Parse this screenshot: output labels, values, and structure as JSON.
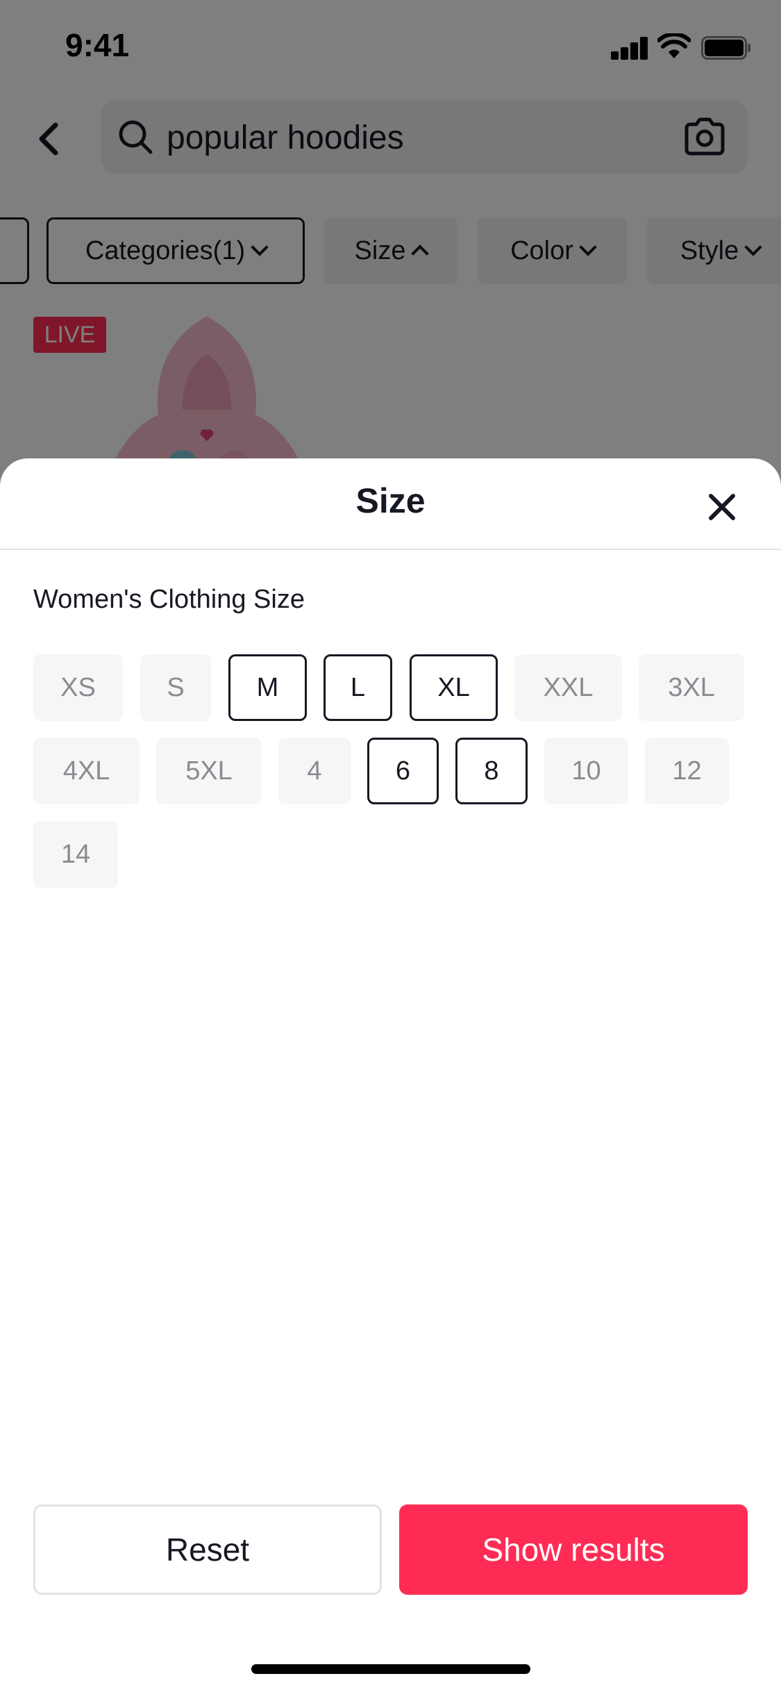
{
  "status_bar": {
    "time": "9:41"
  },
  "search": {
    "query": "popular hoodies"
  },
  "filters": [
    {
      "label": "Categories(1)",
      "caret": "down",
      "selected": true
    },
    {
      "label": "Size",
      "caret": "up",
      "selected": false
    },
    {
      "label": "Color",
      "caret": "down",
      "selected": false
    },
    {
      "label": "Style",
      "caret": "down",
      "selected": false
    }
  ],
  "product": {
    "badge": "LIVE"
  },
  "sheet": {
    "title": "Size",
    "section_title": "Women's Clothing Size",
    "options": [
      {
        "label": "XS",
        "selected": false
      },
      {
        "label": "S",
        "selected": false
      },
      {
        "label": "M",
        "selected": true
      },
      {
        "label": "L",
        "selected": true
      },
      {
        "label": "XL",
        "selected": true
      },
      {
        "label": "XXL",
        "selected": false
      },
      {
        "label": "3XL",
        "selected": false
      },
      {
        "label": "4XL",
        "selected": false
      },
      {
        "label": "5XL",
        "selected": false
      },
      {
        "label": "4",
        "selected": false
      },
      {
        "label": "6",
        "selected": true
      },
      {
        "label": "8",
        "selected": true
      },
      {
        "label": "10",
        "selected": false
      },
      {
        "label": "12",
        "selected": false
      },
      {
        "label": "14",
        "selected": false
      }
    ],
    "reset_label": "Reset",
    "show_label": "Show results"
  },
  "colors": {
    "accent": "#fe2c55",
    "text": "#161823",
    "muted": "#8a8b91",
    "chip_bg": "#f6f6f7"
  },
  "icons": [
    "back-chevron-icon",
    "search-icon",
    "camera-icon",
    "close-icon"
  ]
}
